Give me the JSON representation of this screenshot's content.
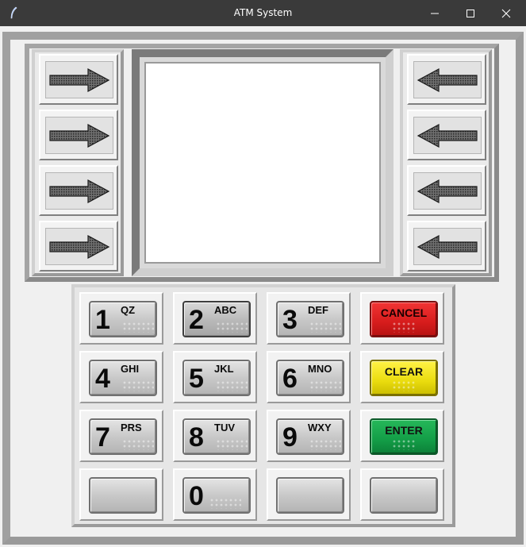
{
  "window": {
    "title": "ATM System",
    "controls": [
      "minimize-icon",
      "maximize-icon",
      "close-icon"
    ]
  },
  "side_buttons": {
    "left": [
      {
        "icon": "arrow-right-icon"
      },
      {
        "icon": "arrow-right-icon"
      },
      {
        "icon": "arrow-right-icon"
      },
      {
        "icon": "arrow-right-icon"
      }
    ],
    "right": [
      {
        "icon": "arrow-left-icon"
      },
      {
        "icon": "arrow-left-icon"
      },
      {
        "icon": "arrow-left-icon"
      },
      {
        "icon": "arrow-left-icon"
      }
    ]
  },
  "screen": {
    "content": ""
  },
  "keypad": {
    "keys": {
      "k1": {
        "digit": "1",
        "letters": "QZ"
      },
      "k2": {
        "digit": "2",
        "letters": "ABC"
      },
      "k3": {
        "digit": "3",
        "letters": "DEF"
      },
      "k4": {
        "digit": "4",
        "letters": "GHI"
      },
      "k5": {
        "digit": "5",
        "letters": "JKL"
      },
      "k6": {
        "digit": "6",
        "letters": "MNO"
      },
      "k7": {
        "digit": "7",
        "letters": "PRS"
      },
      "k8": {
        "digit": "8",
        "letters": "TUV"
      },
      "k9": {
        "digit": "9",
        "letters": "WXY"
      },
      "k0": {
        "digit": "0",
        "letters": ""
      }
    },
    "cancel": {
      "label": "CANCEL",
      "color": "#d61c1c"
    },
    "clear": {
      "label": "CLEAR",
      "color": "#eadc0e"
    },
    "enter": {
      "label": "ENTER",
      "color": "#139d47"
    }
  }
}
